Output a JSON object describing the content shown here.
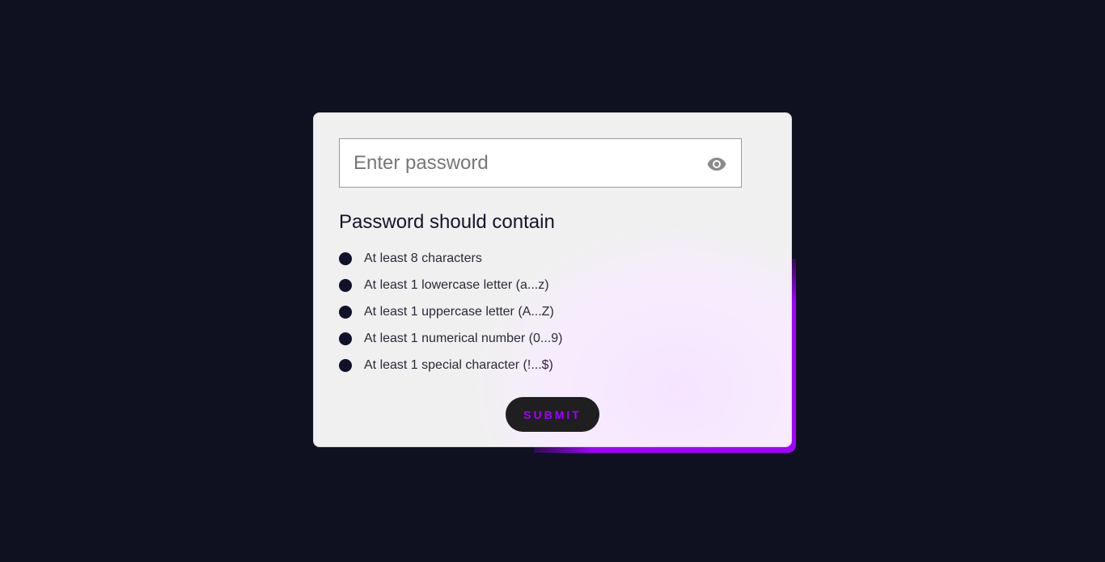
{
  "password_field": {
    "placeholder": "Enter password",
    "value": "",
    "toggle_icon": "eye-icon"
  },
  "requirements": {
    "title": "Password should contain",
    "items": [
      {
        "label": "At least 8 characters",
        "met": false
      },
      {
        "label": "At least 1 lowercase letter (a...z)",
        "met": false
      },
      {
        "label": "At least 1 uppercase letter (A...Z)",
        "met": false
      },
      {
        "label": "At least 1 numerical number (0...9)",
        "met": false
      },
      {
        "label": "At least 1 special character (!...$)",
        "met": false
      }
    ]
  },
  "submit": {
    "label": "SUBMIT"
  },
  "colors": {
    "background": "#0f1020",
    "card": "#f0f0f0",
    "accent": "#a100ff",
    "dot": "#10112a",
    "button": "#1f1f1f"
  }
}
